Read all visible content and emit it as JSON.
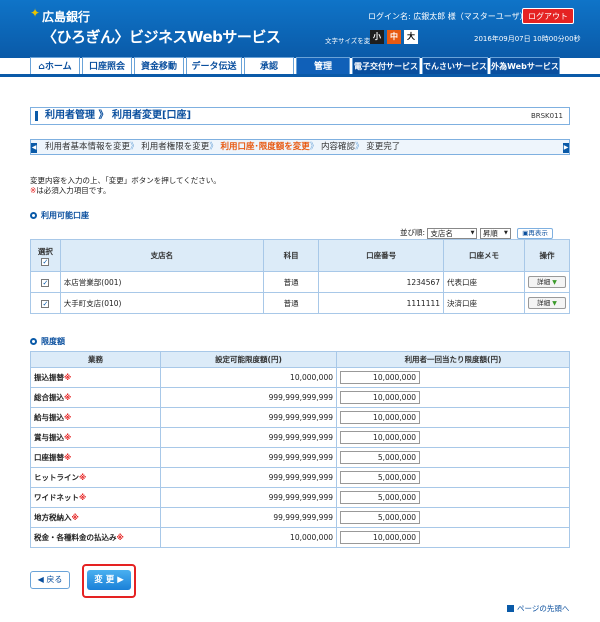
{
  "header": {
    "bank_name": "広島銀行",
    "service_name": "〈ひろぎん〉ビジネスWebサービス",
    "login_label": "ログイン名: 広銀太郎 様（マスターユーザ）",
    "logout_label": "ログアウト",
    "font_size_label": "文字サイズを変更",
    "font_small": "小",
    "font_medium": "中",
    "font_large": "大",
    "datetime": "2016年09月07日 10時00分00秒"
  },
  "nav": {
    "tabs": [
      "ホーム",
      "口座照会",
      "資金移動",
      "データ伝送",
      "承認",
      "管理",
      "電子交付サービス",
      "でんさいサービス",
      "外為Webサービス"
    ],
    "active_tab": "管理"
  },
  "page": {
    "title": "利用者管理 》 利用者変更[口座]",
    "screen_id": "BRSK011",
    "steps": [
      "利用者基本情報を変更",
      "利用者権限を変更",
      "利用口座･限度額を変更",
      "内容確認",
      "変更完了"
    ],
    "current_step": "利用口座･限度額を変更",
    "instruction": "変更内容を入力の上、「変更」ボタンを押してください。",
    "required_mark": "※",
    "required_note": "は必須入力項目です。"
  },
  "accounts": {
    "section_title": "利用可能口座",
    "sort_label": "並び順:",
    "sort_field": "支店名",
    "sort_order": "昇順",
    "resort_label": "再表示",
    "headers": {
      "select": "選択",
      "branch": "支店名",
      "subject": "科目",
      "number": "口座番号",
      "memo": "口座メモ",
      "action": "操作"
    },
    "rows": [
      {
        "branch": "本店営業部(001)",
        "subject": "普通",
        "number": "1234567",
        "memo": "代表口座",
        "action": "詳細"
      },
      {
        "branch": "大手町支店(010)",
        "subject": "普通",
        "number": "1111111",
        "memo": "決済口座",
        "action": "詳細"
      }
    ]
  },
  "limits": {
    "section_title": "限度額",
    "headers": {
      "business": "業務",
      "configurable": "設定可能限度額(円)",
      "per_use": "利用者一回当たり限度額(円)"
    },
    "rows": [
      {
        "name": "振込振替",
        "configurable": "10,000,000",
        "value": "10,000,000"
      },
      {
        "name": "総合振込",
        "configurable": "999,999,999,999",
        "value": "10,000,000"
      },
      {
        "name": "給与振込",
        "configurable": "999,999,999,999",
        "value": "10,000,000"
      },
      {
        "name": "賞与振込",
        "configurable": "999,999,999,999",
        "value": "10,000,000"
      },
      {
        "name": "口座振替",
        "configurable": "999,999,999,999",
        "value": "5,000,000"
      },
      {
        "name": "ヒットライン",
        "configurable": "999,999,999,999",
        "value": "5,000,000"
      },
      {
        "name": "ワイドネット",
        "configurable": "999,999,999,999",
        "value": "5,000,000"
      },
      {
        "name": "地方税納入",
        "configurable": "99,999,999,999",
        "value": "5,000,000"
      },
      {
        "name": "税金・各種料金の払込み",
        "configurable": "10,000,000",
        "value": "10,000,000"
      }
    ]
  },
  "buttons": {
    "back": "戻る",
    "change": "変 更"
  },
  "page_top_link": "ページの先頭へ",
  "colors": {
    "brand": "#0a5aa8",
    "accent": "#e85a12",
    "alert": "#e52222"
  }
}
